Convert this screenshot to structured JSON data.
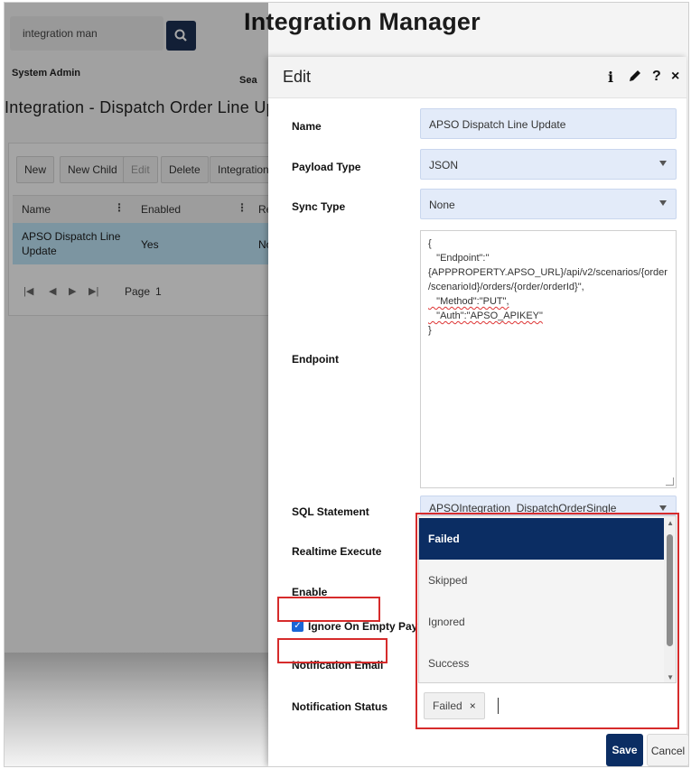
{
  "app": {
    "title": "Integration Manager",
    "search_value": "integration man",
    "user": "System Admin",
    "header_fragment": "Sea",
    "page_title": "Integration - Dispatch Order Line Up"
  },
  "toolbar": {
    "new": "New",
    "new_child": "New Child",
    "edit": "Edit",
    "delete": "Delete",
    "integration": "Integration"
  },
  "grid": {
    "headers": [
      "Name",
      "Enabled",
      "Re"
    ],
    "row": {
      "name_line1": "APSO Dispatch Line",
      "name_line2": "Update",
      "enabled": "Yes",
      "third": "No"
    },
    "pager": {
      "first": "|◀",
      "prev": "◀",
      "next": "▶",
      "last": "▶|",
      "page_label": "Page",
      "page_value": "1"
    }
  },
  "modal": {
    "title": "Edit",
    "icons": {
      "info": "i",
      "help": "?",
      "close": "×"
    },
    "fields": {
      "name_label": "Name",
      "name_value": "APSO Dispatch Line Update",
      "payload_label": "Payload Type",
      "payload_value": "JSON",
      "sync_label": "Sync Type",
      "sync_value": "None",
      "endpoint_label": "Endpoint",
      "sql_label": "SQL Statement",
      "sql_value": "APSOIntegration_DispatchOrderSingle",
      "realtime_label": "Realtime Execute",
      "enable_label": "Enable",
      "ignore_label": "Ignore On Empty Payload",
      "notif_email_label": "Notification Email",
      "notif_status_label": "Notification Status"
    },
    "endpoint_code": {
      "l1": "{",
      "l2": "   \"Endpoint\":\"",
      "l3": "{APPPROPERTY.APSO_URL}/api/v2/scenarios/{order",
      "l4": "/scenarioId}/orders/{order/orderId}\",",
      "l5": "   \"Method\":\"PUT\",",
      "l6": "   \"Auth\":\"APSO_APIKEY\"",
      "l7": "}"
    },
    "status_options": [
      "Failed",
      "Skipped",
      "Ignored",
      "Success"
    ],
    "selected_option": "Failed",
    "tag_value": "Failed",
    "tag_remove": "×",
    "save_label": "Save",
    "cancel_label": "Cancel"
  },
  "colors": {
    "primary": "#0b2d63",
    "field_bg": "#e3ebf9",
    "highlight_red": "#d62b2b",
    "row_selected": "#bde3f5"
  }
}
